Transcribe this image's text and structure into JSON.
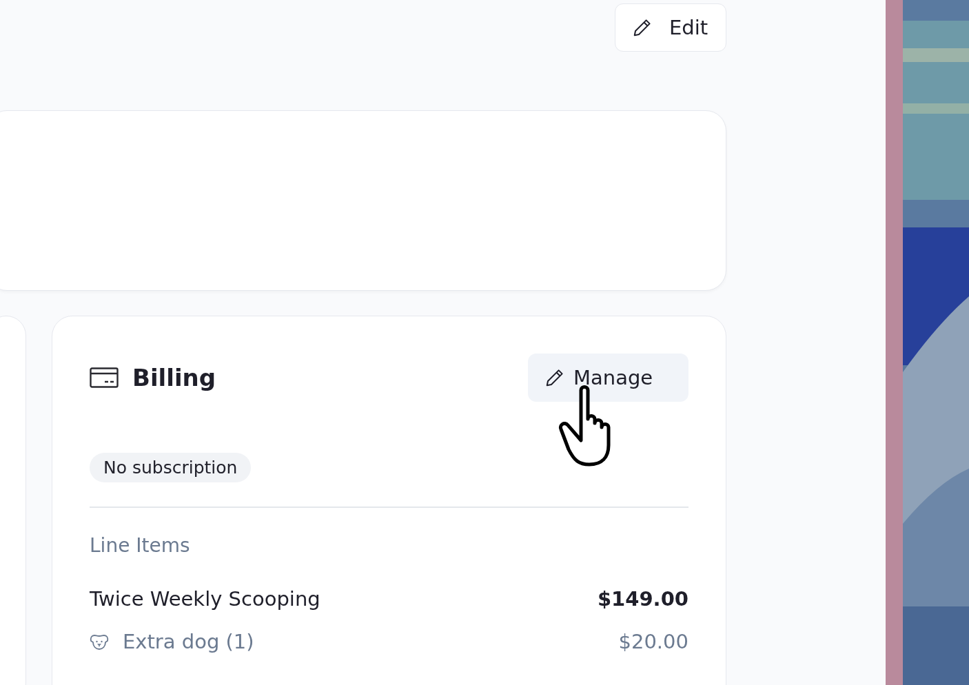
{
  "header": {
    "edit_button": "Edit"
  },
  "billing": {
    "title": "Billing",
    "manage_button": "Manage",
    "status_badge": "No subscription",
    "line_items_heading": "Line Items",
    "line_items": [
      {
        "kind": "service",
        "name": "Twice Weekly Scooping",
        "price": "$149.00"
      },
      {
        "kind": "addon",
        "name": "Extra dog (1)",
        "price": "$20.00"
      }
    ]
  }
}
